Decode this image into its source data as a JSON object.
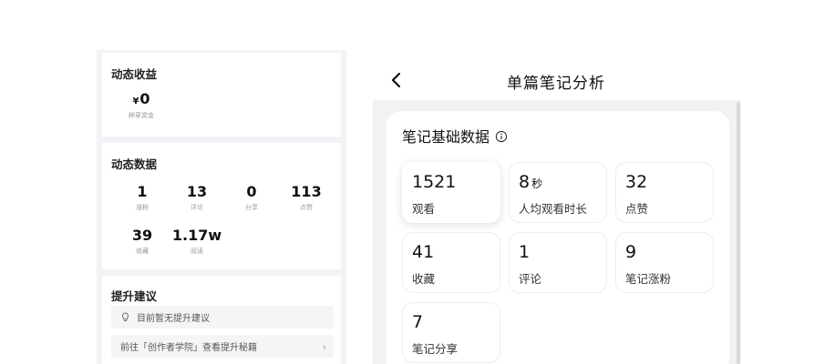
{
  "revenue": {
    "title": "动态收益",
    "currency": "¥",
    "amount": "0",
    "label": "种草赏金"
  },
  "dynamic_data": {
    "title": "动态数据",
    "stats": [
      {
        "value": "1",
        "label": "涨粉"
      },
      {
        "value": "13",
        "label": "评论"
      },
      {
        "value": "0",
        "label": "分享"
      },
      {
        "value": "113",
        "label": "点赞"
      },
      {
        "value": "39",
        "label": "收藏"
      },
      {
        "value": "1.17w",
        "label": "阅读"
      }
    ]
  },
  "suggestions": {
    "title": "提升建议",
    "empty_text": "目前暂无提升建议",
    "academy_link": "前往「创作者学院」查看提升秘籍"
  },
  "note_analysis": {
    "page_title": "单篇笔记分析",
    "section_title": "笔记基础数据",
    "metrics": [
      {
        "value": "1521",
        "unit": "",
        "label": "观看"
      },
      {
        "value": "8",
        "unit": "秒",
        "label": "人均观看时长"
      },
      {
        "value": "32",
        "unit": "",
        "label": "点赞"
      },
      {
        "value": "41",
        "unit": "",
        "label": "收藏"
      },
      {
        "value": "1",
        "unit": "",
        "label": "评论"
      },
      {
        "value": "9",
        "unit": "",
        "label": "笔记涨粉"
      },
      {
        "value": "7",
        "unit": "",
        "label": "笔记分享"
      }
    ]
  },
  "icons": {
    "back": "chevron-left-icon",
    "info": "info-circle-icon",
    "bulb": "lightbulb-icon",
    "link_arrow": "chevron-right-icon"
  },
  "colors": {
    "panel_bg": "#f3f3f7",
    "card_bg": "#ffffff",
    "text_primary": "#111111",
    "text_muted": "#999999"
  }
}
